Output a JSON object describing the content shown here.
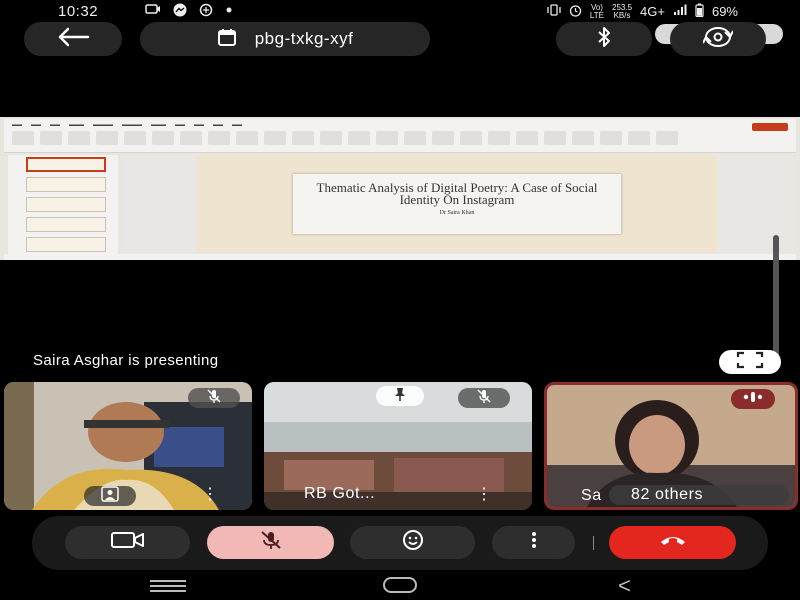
{
  "status_bar": {
    "time": "10:32",
    "volte_line1": "Vo)",
    "volte_line2": "LTE",
    "speed_value": "253.5",
    "speed_unit": "KB/s",
    "network": "4G+",
    "battery": "69%",
    "icons": [
      "camera-icon",
      "messenger-icon",
      "data-saver-icon",
      "notification-dot-icon",
      "vibrate-icon",
      "alarm-icon",
      "signal-icon",
      "battery-icon"
    ]
  },
  "top_bar": {
    "meeting_code": "pbg-txkg-xyf",
    "icons": [
      "back-arrow-icon",
      "calendar-icon",
      "bluetooth-icon",
      "switch-camera-icon"
    ]
  },
  "slide": {
    "title": "Thematic Analysis of Digital Poetry: A Case of Social Identity On Instagram",
    "author": "Dr Saira Khan"
  },
  "presenting_text": "Saira Asghar is presenting",
  "participants": [
    {
      "name": "",
      "muted": true
    },
    {
      "name": "RB Got...",
      "muted": true,
      "pinned": true
    },
    {
      "name": "Sa",
      "others_label": "82 others",
      "speaking": true
    }
  ],
  "controls": {
    "icons": [
      "video-camera-icon",
      "mic-off-icon",
      "emoji-icon",
      "more-vert-icon",
      "end-call-icon"
    ]
  },
  "colors": {
    "background": "#000000",
    "pill": "#262626",
    "mic_muted": "#f2b8b5",
    "end_call": "#e3261e",
    "speaking_border": "#8a2c2c"
  }
}
